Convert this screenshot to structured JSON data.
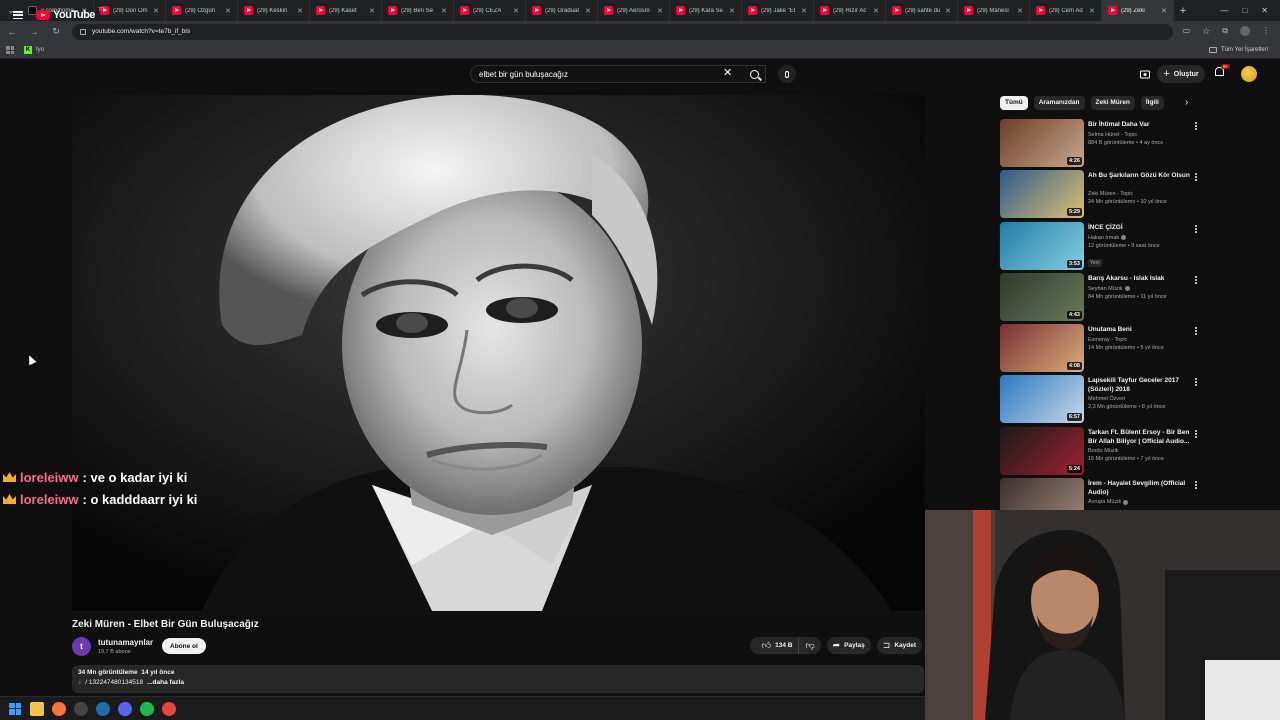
{
  "browser": {
    "tabs": [
      {
        "label": "x.com/home",
        "icon": "x-icon"
      },
      {
        "label": "(29) Don Om",
        "icon": "youtube-icon"
      },
      {
        "label": "(29) Özgün",
        "icon": "youtube-icon"
      },
      {
        "label": "(29) Keskin",
        "icon": "youtube-icon"
      },
      {
        "label": "(29) Kaset",
        "icon": "youtube-icon"
      },
      {
        "label": "(29) Ben Se",
        "icon": "youtube-icon"
      },
      {
        "label": "(29) CEZA",
        "icon": "youtube-icon"
      },
      {
        "label": "(29) Graduat",
        "icon": "youtube-icon"
      },
      {
        "label": "(29) Aerosm",
        "icon": "youtube-icon"
      },
      {
        "label": "(29) Kara Se",
        "icon": "youtube-icon"
      },
      {
        "label": "(29) Jake \"Et",
        "icon": "youtube-icon"
      },
      {
        "label": "(29) Hızır Ac",
        "icon": "youtube-icon"
      },
      {
        "label": "(29) sahte du",
        "icon": "youtube-icon"
      },
      {
        "label": "(29) Mânesi",
        "icon": "youtube-icon"
      },
      {
        "label": "(29) Cem Ad",
        "icon": "youtube-icon"
      },
      {
        "label": "(29) Zeki",
        "icon": "youtube-icon",
        "active": true
      }
    ],
    "url": "youtube.com/watch?v=te7b_if_bls",
    "bookmarks": {
      "kick_label": "Iyo",
      "all_bookmarks": "Tüm Yer İşaretleri"
    }
  },
  "youtube": {
    "logo_text": "YouTube",
    "logo_country": "TR",
    "search": {
      "value": "elbet bir gün buluşacağız",
      "placeholder": "Ara"
    },
    "create_label": "Oluştur",
    "notif_count": "9+"
  },
  "chat": [
    {
      "user": "loreleiww",
      "message": ": ve o kadar iyi ki"
    },
    {
      "user": "loreleiww",
      "message": ": o kadddaarr iyi ki"
    }
  ],
  "video": {
    "title": "Zeki Müren - Elbet Bir Gün Buluşacağız",
    "channel": "tutunamaynlar",
    "channel_initial": "t",
    "subscribers": "19,7 B abone",
    "subscribe_label": "Abone ol",
    "likes": "134 B",
    "share_label": "Paylaş",
    "save_label": "Kaydet",
    "views": "34 Mn görüntüleme",
    "age": "14 yıl önce",
    "desc_tag": "/ 132247480134518",
    "desc_more": "...daha fazla"
  },
  "chips": [
    "Tümü",
    "Aramanızdan",
    "Zeki Müren",
    "İlgili"
  ],
  "recommendations": [
    {
      "title": "Bir İhtimal Daha Var",
      "channel": "Selma Hünel - Topic",
      "meta": "884 B görüntüleme • 4 ay önce",
      "duration": "4:26",
      "verified": false,
      "colors": [
        "#6b3e2a",
        "#c9a88a"
      ]
    },
    {
      "title": "Ah Bu Şarkıların Gözü Kör Olsun",
      "channel": "Zeki Müren - Topic",
      "meta": "24 Mn görüntüleme • 10 yıl önce",
      "duration": "5:29",
      "verified": false,
      "colors": [
        "#2d5a8c",
        "#e0c070"
      ]
    },
    {
      "title": "İNCE ÇİZGİ",
      "channel": "Hakan Irmak",
      "meta": "12 görüntüleme • 9 saat önce",
      "duration": "3:53",
      "verified": true,
      "new": "Yeni",
      "colors": [
        "#1e7fa8",
        "#88cde0"
      ]
    },
    {
      "title": "Barış Akarsu - Islak Islak",
      "channel": "Seyhan Müzik",
      "meta": "84 Mn görüntüleme • 11 yıl önce",
      "duration": "4:43",
      "verified": true,
      "colors": [
        "#2f3a2a",
        "#6a7a5a"
      ]
    },
    {
      "title": "Unutama Beni",
      "channel": "Esmeray - Topic",
      "meta": "14 Mn görüntüleme • 5 yıl önce",
      "duration": "4:08",
      "verified": false,
      "colors": [
        "#7a2e34",
        "#d8b07a"
      ]
    },
    {
      "title": "Lapsekili Tayfur Geceler 2017 (Sözleri) 2018",
      "channel": "Mehmet Özveri",
      "meta": "2,3 Mn görüntüleme • 8 yıl önce",
      "duration": "6:57",
      "verified": false,
      "colors": [
        "#2a78c0",
        "#c8d8e8"
      ]
    },
    {
      "title": "Tarkan Ft. Bülent Ersoy - Bir Ben Bir Allah Biliyor | Official Audio...",
      "channel": "Bordo Müzik",
      "meta": "16 Mn görüntüleme • 7 yıl önce",
      "duration": "5:24",
      "verified": false,
      "colors": [
        "#1a1a1a",
        "#a02030"
      ]
    },
    {
      "title": "İrem - Hayalet Sevgilim (Official Audio)",
      "channel": "Avrupa Müzik",
      "meta": "",
      "duration": "",
      "verified": true,
      "colors": [
        "#3a3030",
        "#a08878"
      ]
    }
  ],
  "taskbar_icons": [
    "windows-icon",
    "file-explorer-icon",
    "firefox-icon",
    "obs-icon",
    "steam-icon",
    "discord-icon",
    "spotify-icon",
    "chrome-icon"
  ]
}
